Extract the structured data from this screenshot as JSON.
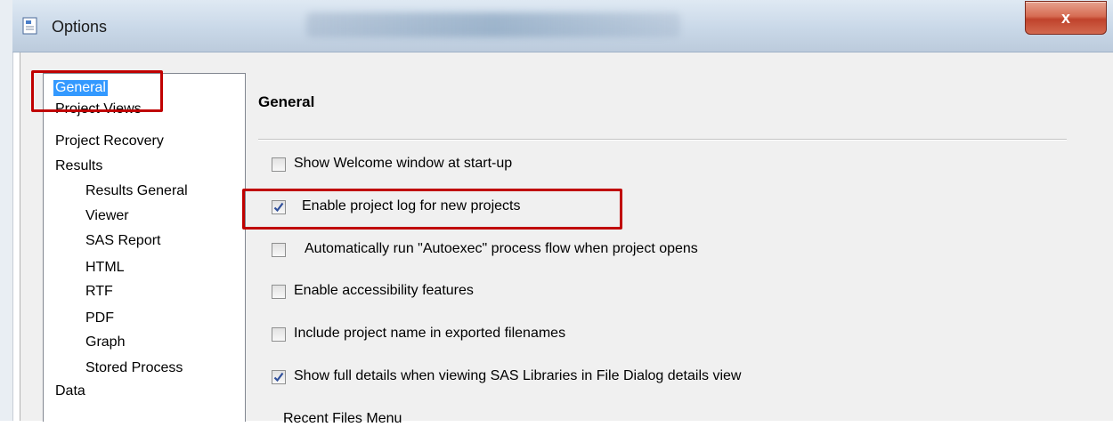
{
  "window": {
    "title": "Options",
    "close_label": "x"
  },
  "nav": {
    "items": [
      {
        "label": "General",
        "selected": true
      },
      {
        "label": "Project Views"
      },
      {
        "label": "Project Recovery"
      },
      {
        "label": "Results"
      },
      {
        "label": "Results General"
      },
      {
        "label": "Viewer"
      },
      {
        "label": "SAS Report"
      },
      {
        "label": "HTML"
      },
      {
        "label": "RTF"
      },
      {
        "label": "PDF"
      },
      {
        "label": "Graph"
      },
      {
        "label": "Stored Process"
      },
      {
        "label": "Data"
      }
    ]
  },
  "panel": {
    "title": "General",
    "options": [
      {
        "label": "Show Welcome window at start-up",
        "checked": false
      },
      {
        "label": "Enable project log for new projects",
        "checked": true
      },
      {
        "label": "Automatically run \"Autoexec\" process flow when project opens",
        "checked": false
      },
      {
        "label": "Enable accessibility features",
        "checked": false
      },
      {
        "label": "Include project name in exported filenames",
        "checked": false
      },
      {
        "label": "Show full details when viewing SAS Libraries in File Dialog details view",
        "checked": true
      }
    ],
    "next_section_label": "Recent Files Menu"
  },
  "colors": {
    "highlight_box": "#c00000",
    "selection": "#3399ff",
    "check": "#2f4f9a"
  }
}
